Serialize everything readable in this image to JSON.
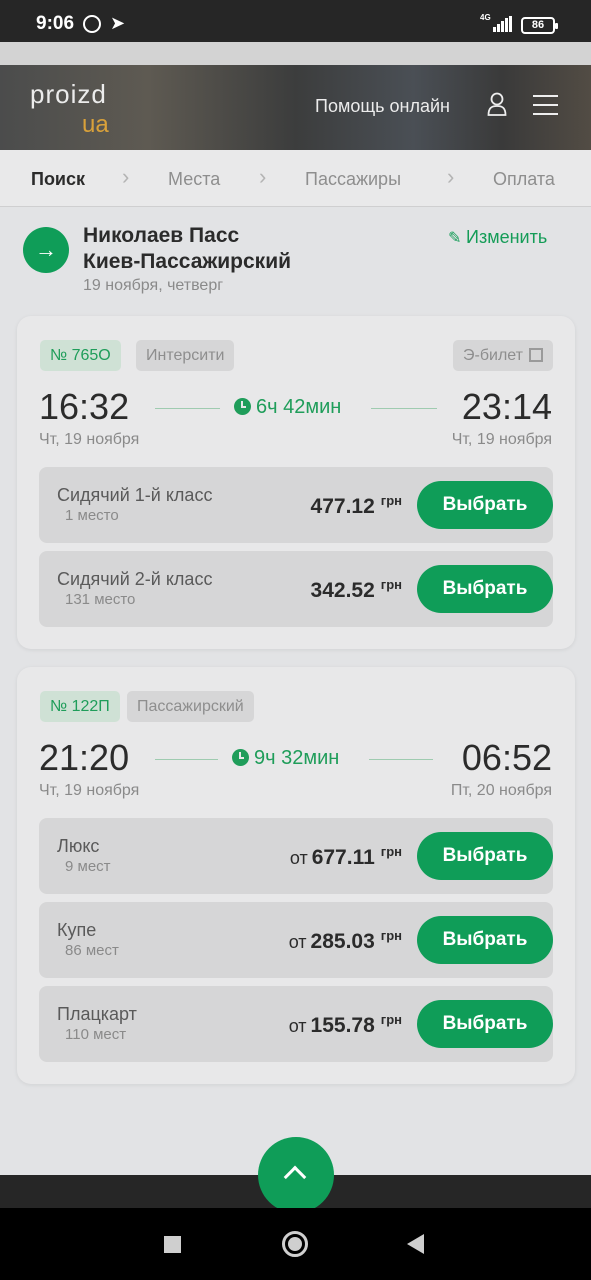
{
  "status_bar": {
    "time": "9:06",
    "network": "4G",
    "battery": "86"
  },
  "header": {
    "logo_top": "proizd",
    "logo_bottom": "ua",
    "help": "Помощь онлайн"
  },
  "steps": [
    {
      "label": "Поиск",
      "active": true
    },
    {
      "label": "Места",
      "active": false
    },
    {
      "label": "Пассажиры",
      "active": false
    },
    {
      "label": "Оплата",
      "active": false
    }
  ],
  "route": {
    "from": "Николаев Пасс",
    "to": "Киев-Пассажирский",
    "date": "19 ноября, четверг",
    "edit": "Изменить"
  },
  "trains": [
    {
      "number": "№ 765О",
      "type": "Интерсити",
      "eticket": "Э-билет",
      "dep_time": "16:32",
      "dep_date": "Чт, 19 ноября",
      "duration": "6ч 42мин",
      "arr_time": "23:14",
      "arr_date": "Чт, 19 ноября",
      "fares": [
        {
          "class": "Сидячий 1-й класс",
          "seats": "1 место",
          "prefix": "",
          "price": "477.12",
          "currency": "грн",
          "button": "Выбрать"
        },
        {
          "class": "Сидячий 2-й класс",
          "seats": "131 место",
          "prefix": "",
          "price": "342.52",
          "currency": "грн",
          "button": "Выбрать"
        }
      ]
    },
    {
      "number": "№ 122П",
      "type": "Пассажирский",
      "dep_time": "21:20",
      "dep_date": "Чт, 19 ноября",
      "duration": "9ч 32мин",
      "arr_time": "06:52",
      "arr_date": "Пт, 20 ноября",
      "fares": [
        {
          "class": "Люкс",
          "seats": "9 мест",
          "prefix": "от",
          "price": "677.11",
          "currency": "грн",
          "button": "Выбрать"
        },
        {
          "class": "Купе",
          "seats": "86 мест",
          "prefix": "от",
          "price": "285.03",
          "currency": "грн",
          "button": "Выбрать"
        },
        {
          "class": "Плацкарт",
          "seats": "110 мест",
          "prefix": "от",
          "price": "155.78",
          "currency": "грн",
          "button": "Выбрать"
        }
      ]
    }
  ],
  "colors": {
    "accent": "#0f9d58",
    "logo_accent": "#d9a13a"
  },
  "icons": [
    "alarm-icon",
    "telegram-icon",
    "signal-icon",
    "battery-icon",
    "user-icon",
    "menu-icon",
    "arrow-right-icon",
    "pencil-icon",
    "qr-icon",
    "clock-icon",
    "chevron-up-icon"
  ]
}
